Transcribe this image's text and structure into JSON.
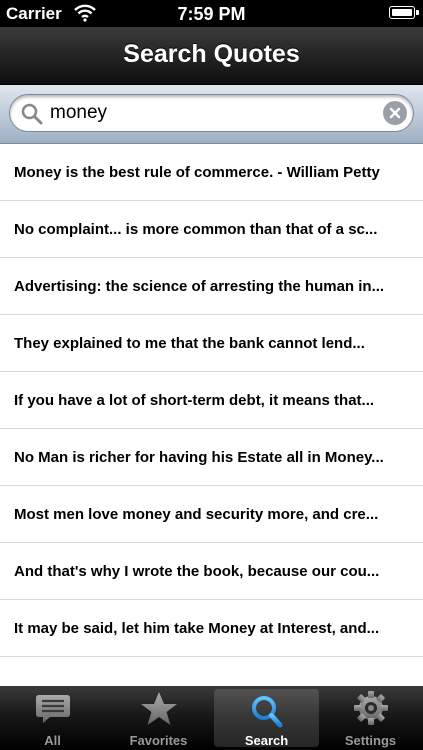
{
  "status_bar": {
    "carrier": "Carrier",
    "time": "7:59 PM"
  },
  "nav": {
    "title": "Search Quotes"
  },
  "search": {
    "value": "money"
  },
  "results": [
    "Money is the best rule of commerce. - William Petty",
    "No complaint... is more common than that of a sc...",
    "Advertising: the science of arresting the human in...",
    "They explained to me that the bank cannot lend...",
    "If you have a lot of short-term debt, it means that...",
    "No Man is richer for having his Estate all in Money...",
    "Most men love money and security more, and cre...",
    "And that's why I wrote the book, because our cou...",
    "It may be said, let him take Money at Interest, and..."
  ],
  "tabs": [
    {
      "label": "All",
      "icon": "quote-bubble-icon"
    },
    {
      "label": "Favorites",
      "icon": "star-icon"
    },
    {
      "label": "Search",
      "icon": "search-icon",
      "selected": true
    },
    {
      "label": "Settings",
      "icon": "gear-icon"
    }
  ]
}
